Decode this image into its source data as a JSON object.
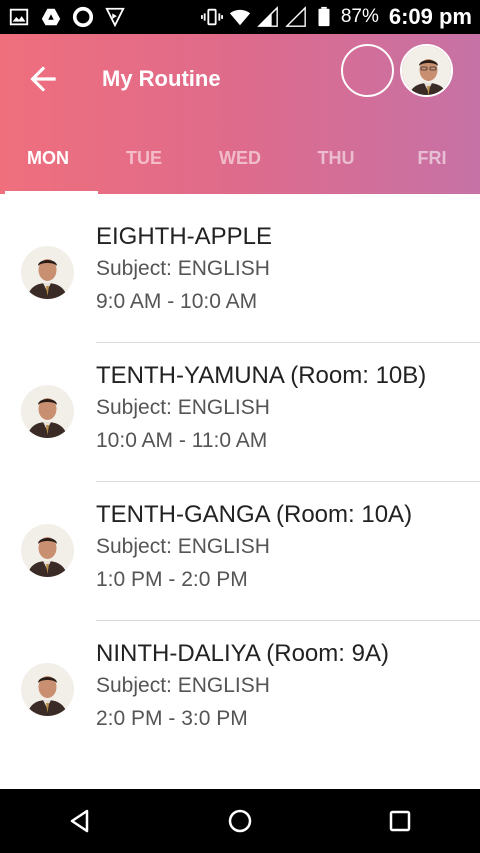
{
  "status": {
    "battery": "87%",
    "time": "6:09 pm",
    "icons": [
      "gallery-icon",
      "drive-icon",
      "opera-icon",
      "vpn-icon",
      "vibrate-icon",
      "wifi-icon",
      "signal-icon",
      "signal-icon-2",
      "battery-icon"
    ]
  },
  "appbar": {
    "title": "My Routine",
    "back_icon": "arrow-left-icon",
    "accent_start": "#ef6f7d",
    "accent_end": "#c672a6"
  },
  "tabs": [
    "MON",
    "TUE",
    "WED",
    "THU",
    "FRI"
  ],
  "active_tab": "MON",
  "classes": [
    {
      "title": "EIGHTH-APPLE",
      "subject": "Subject: ENGLISH",
      "time": "9:0 AM - 10:0 AM"
    },
    {
      "title": "TENTH-YAMUNA (Room: 10B)",
      "subject": "Subject: ENGLISH",
      "time": "10:0 AM - 11:0 AM"
    },
    {
      "title": "TENTH-GANGA (Room: 10A)",
      "subject": "Subject: ENGLISH",
      "time": "1:0 PM - 2:0 PM"
    },
    {
      "title": "NINTH-DALIYA (Room: 9A)",
      "subject": "Subject: ENGLISH",
      "time": "2:0 PM - 3:0 PM"
    }
  ],
  "navbar": [
    "back-triangle-icon",
    "home-circle-icon",
    "recents-square-icon"
  ]
}
